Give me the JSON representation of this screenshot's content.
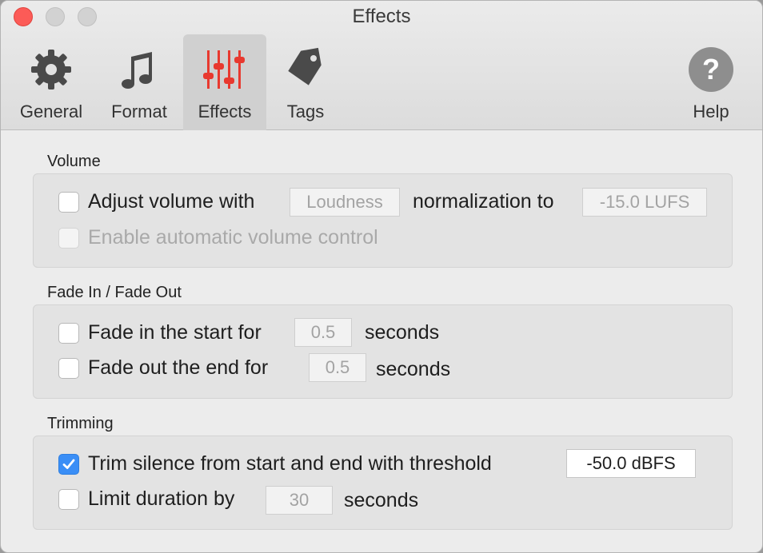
{
  "window": {
    "title": "Effects"
  },
  "toolbar": {
    "items": [
      {
        "label": "General",
        "icon": "gear-icon"
      },
      {
        "label": "Format",
        "icon": "music-note-icon"
      },
      {
        "label": "Effects",
        "icon": "equalizer-sliders-icon",
        "selected": true
      },
      {
        "label": "Tags",
        "icon": "tag-icon"
      }
    ],
    "help": {
      "label": "Help",
      "icon": "question-mark-icon"
    }
  },
  "volume": {
    "title": "Volume",
    "adjust": {
      "label_before": "Adjust volume with",
      "mode": "Loudness",
      "label_after": "normalization to",
      "value": "-15.0 LUFS",
      "checked": false
    },
    "auto": {
      "label": "Enable automatic volume control",
      "checked": false,
      "disabled": true
    }
  },
  "fade": {
    "title": "Fade In / Fade Out",
    "fade_in": {
      "label": "Fade in the start for",
      "value": "0.5",
      "unit": "seconds",
      "checked": false
    },
    "fade_out": {
      "label": "Fade out the end for",
      "value": "0.5",
      "unit": "seconds",
      "checked": false
    }
  },
  "trimming": {
    "title": "Trimming",
    "trim": {
      "label": "Trim silence from start and end with threshold",
      "value": "-50.0 dBFS",
      "checked": true
    },
    "limit": {
      "label": "Limit duration by",
      "value": "30",
      "unit": "seconds",
      "checked": false
    }
  },
  "colors": {
    "accent": "#3a8ef6",
    "effects_icon": "#e8392f",
    "close": "#fc5b57"
  }
}
